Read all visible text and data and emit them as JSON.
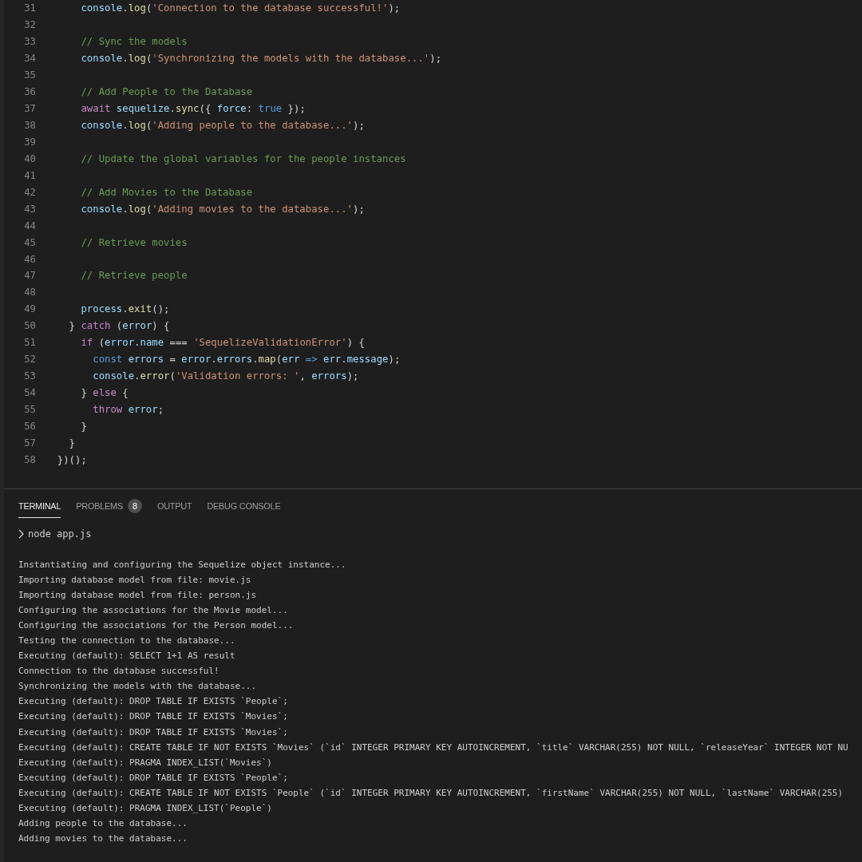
{
  "editor": {
    "lines": [
      {
        "number": "31",
        "tokens": [
          {
            "kind": "var",
            "text": "      console"
          },
          {
            "kind": "plain",
            "text": "."
          },
          {
            "kind": "fn",
            "text": "log"
          },
          {
            "kind": "plain",
            "text": "("
          },
          {
            "kind": "string",
            "text": "'Connection to the database successful!'"
          },
          {
            "kind": "plain",
            "text": ");"
          }
        ]
      },
      {
        "number": "32"
      },
      {
        "number": "33",
        "tokens": [
          {
            "kind": "comment",
            "text": "      // Sync the models"
          }
        ]
      },
      {
        "number": "34",
        "tokens": [
          {
            "kind": "var",
            "text": "      console"
          },
          {
            "kind": "plain",
            "text": "."
          },
          {
            "kind": "fn",
            "text": "log"
          },
          {
            "kind": "plain",
            "text": "("
          },
          {
            "kind": "string",
            "text": "'Synchronizing the models with the database...'"
          },
          {
            "kind": "plain",
            "text": ");"
          }
        ]
      },
      {
        "number": "35"
      },
      {
        "number": "36",
        "tokens": [
          {
            "kind": "comment",
            "text": "      // Add People to the Database"
          }
        ]
      },
      {
        "number": "37",
        "tokens": [
          {
            "kind": "keyword",
            "text": "      await"
          },
          {
            "kind": "var",
            "text": " sequelize"
          },
          {
            "kind": "plain",
            "text": "."
          },
          {
            "kind": "fn",
            "text": "sync"
          },
          {
            "kind": "plain",
            "text": "({ "
          },
          {
            "kind": "var",
            "text": "force"
          },
          {
            "kind": "plain",
            "text": ": "
          },
          {
            "kind": "storage",
            "text": "true"
          },
          {
            "kind": "plain",
            "text": " });"
          }
        ]
      },
      {
        "number": "38",
        "tokens": [
          {
            "kind": "var",
            "text": "      console"
          },
          {
            "kind": "plain",
            "text": "."
          },
          {
            "kind": "fn",
            "text": "log"
          },
          {
            "kind": "plain",
            "text": "("
          },
          {
            "kind": "string",
            "text": "'Adding people to the database...'"
          },
          {
            "kind": "plain",
            "text": ");"
          }
        ]
      },
      {
        "number": "39"
      },
      {
        "number": "40",
        "tokens": [
          {
            "kind": "comment",
            "text": "      // Update the global variables for the people instances"
          }
        ]
      },
      {
        "number": "41"
      },
      {
        "number": "42",
        "tokens": [
          {
            "kind": "comment",
            "text": "      // Add Movies to the Database"
          }
        ]
      },
      {
        "number": "43",
        "tokens": [
          {
            "kind": "var",
            "text": "      console"
          },
          {
            "kind": "plain",
            "text": "."
          },
          {
            "kind": "fn",
            "text": "log"
          },
          {
            "kind": "plain",
            "text": "("
          },
          {
            "kind": "string",
            "text": "'Adding movies to the database...'"
          },
          {
            "kind": "plain",
            "text": ");"
          }
        ]
      },
      {
        "number": "44"
      },
      {
        "number": "45",
        "tokens": [
          {
            "kind": "comment",
            "text": "      // Retrieve movies"
          }
        ]
      },
      {
        "number": "46"
      },
      {
        "number": "47",
        "tokens": [
          {
            "kind": "comment",
            "text": "      // Retrieve people"
          }
        ]
      },
      {
        "number": "48"
      },
      {
        "number": "49",
        "tokens": [
          {
            "kind": "var",
            "text": "      process"
          },
          {
            "kind": "plain",
            "text": "."
          },
          {
            "kind": "fn",
            "text": "exit"
          },
          {
            "kind": "plain",
            "text": "();"
          }
        ]
      },
      {
        "number": "50",
        "tokens": [
          {
            "kind": "plain",
            "text": "    } "
          },
          {
            "kind": "keyword",
            "text": "catch"
          },
          {
            "kind": "plain",
            "text": " ("
          },
          {
            "kind": "var",
            "text": "error"
          },
          {
            "kind": "plain",
            "text": ") {"
          }
        ]
      },
      {
        "number": "51",
        "tokens": [
          {
            "kind": "keyword",
            "text": "      if"
          },
          {
            "kind": "plain",
            "text": " ("
          },
          {
            "kind": "var",
            "text": "error"
          },
          {
            "kind": "plain",
            "text": "."
          },
          {
            "kind": "var",
            "text": "name"
          },
          {
            "kind": "plain",
            "text": " === "
          },
          {
            "kind": "string",
            "text": "'SequelizeValidationError'"
          },
          {
            "kind": "plain",
            "text": ") {"
          }
        ]
      },
      {
        "number": "52",
        "tokens": [
          {
            "kind": "storage",
            "text": "        const"
          },
          {
            "kind": "var",
            "text": " errors"
          },
          {
            "kind": "plain",
            "text": " = "
          },
          {
            "kind": "var",
            "text": "error"
          },
          {
            "kind": "plain",
            "text": "."
          },
          {
            "kind": "var",
            "text": "errors"
          },
          {
            "kind": "plain",
            "text": "."
          },
          {
            "kind": "fn",
            "text": "map"
          },
          {
            "kind": "plain",
            "text": "("
          },
          {
            "kind": "var",
            "text": "err"
          },
          {
            "kind": "storage",
            "text": " =>"
          },
          {
            "kind": "var",
            "text": " err"
          },
          {
            "kind": "plain",
            "text": "."
          },
          {
            "kind": "var",
            "text": "message"
          },
          {
            "kind": "plain",
            "text": ");"
          }
        ]
      },
      {
        "number": "53",
        "tokens": [
          {
            "kind": "var",
            "text": "        console"
          },
          {
            "kind": "plain",
            "text": "."
          },
          {
            "kind": "fn",
            "text": "error"
          },
          {
            "kind": "plain",
            "text": "("
          },
          {
            "kind": "string",
            "text": "'Validation errors: '"
          },
          {
            "kind": "plain",
            "text": ", "
          },
          {
            "kind": "var",
            "text": "errors"
          },
          {
            "kind": "plain",
            "text": ");"
          }
        ]
      },
      {
        "number": "54",
        "tokens": [
          {
            "kind": "plain",
            "text": "      } "
          },
          {
            "kind": "keyword",
            "text": "else"
          },
          {
            "kind": "plain",
            "text": " {"
          }
        ]
      },
      {
        "number": "55",
        "tokens": [
          {
            "kind": "keyword",
            "text": "        throw"
          },
          {
            "kind": "var",
            "text": " error"
          },
          {
            "kind": "plain",
            "text": ";"
          }
        ]
      },
      {
        "number": "56",
        "tokens": [
          {
            "kind": "plain",
            "text": "      }"
          }
        ]
      },
      {
        "number": "57",
        "tokens": [
          {
            "kind": "plain",
            "text": "    }"
          }
        ]
      },
      {
        "number": "58",
        "tokens": [
          {
            "kind": "plain",
            "text": "  })();"
          }
        ]
      }
    ]
  },
  "panel": {
    "tabs": [
      {
        "label": "TERMINAL",
        "selected": true
      },
      {
        "label": "PROBLEMS",
        "selected": false,
        "badge": "8"
      },
      {
        "label": "OUTPUT",
        "selected": false
      },
      {
        "label": "DEBUG CONSOLE",
        "selected": false
      }
    ],
    "terminal": {
      "command": "node app.js",
      "output": [
        "Instantiating and configuring the Sequelize object instance...",
        "Importing database model from file: movie.js",
        "Importing database model from file: person.js",
        "Configuring the associations for the Movie model...",
        "Configuring the associations for the Person model...",
        "Testing the connection to the database...",
        "Executing (default): SELECT 1+1 AS result",
        "Connection to the database successful!",
        "Synchronizing the models with the database...",
        "Executing (default): DROP TABLE IF EXISTS `People`;",
        "Executing (default): DROP TABLE IF EXISTS `Movies`;",
        "Executing (default): DROP TABLE IF EXISTS `Movies`;",
        "Executing (default): CREATE TABLE IF NOT EXISTS `Movies` (`id` INTEGER PRIMARY KEY AUTOINCREMENT, `title` VARCHAR(255) NOT NULL, `releaseYear` INTEGER NOT NU",
        "Executing (default): PRAGMA INDEX_LIST(`Movies`)",
        "Executing (default): DROP TABLE IF EXISTS `People`;",
        "Executing (default): CREATE TABLE IF NOT EXISTS `People` (`id` INTEGER PRIMARY KEY AUTOINCREMENT, `firstName` VARCHAR(255) NOT NULL, `lastName` VARCHAR(255)",
        "Executing (default): PRAGMA INDEX_LIST(`People`)",
        "Adding people to the database...",
        "Adding movies to the database..."
      ]
    }
  }
}
